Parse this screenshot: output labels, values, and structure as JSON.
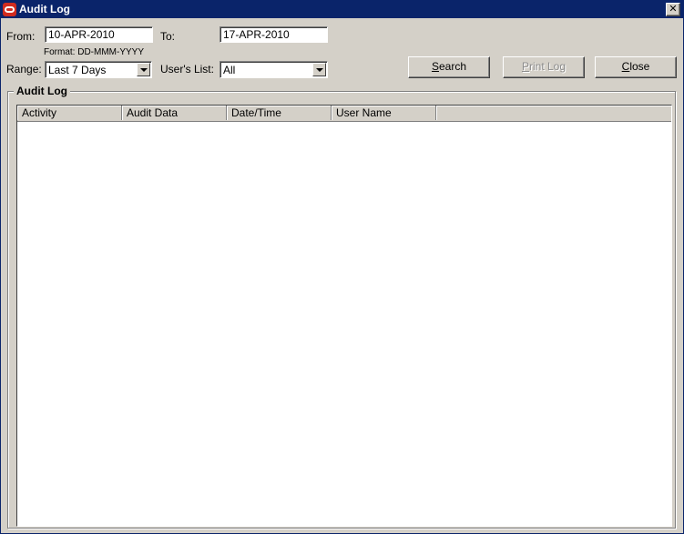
{
  "window": {
    "title": "Audit Log",
    "close_glyph": "✕"
  },
  "form": {
    "from_label": "From:",
    "from_value": "10-APR-2010",
    "to_label": "To:",
    "to_value": "17-APR-2010",
    "format_hint": "Format: DD-MMM-YYYY",
    "range_label": "Range:",
    "range_value": "Last 7 Days",
    "users_label": "User's List:",
    "users_value": "All"
  },
  "buttons": {
    "search_accel": "S",
    "search_rest": "earch",
    "print_accel": "P",
    "print_rest": "rint Log",
    "close_accel": "C",
    "close_rest": "lose"
  },
  "group": {
    "title": "Audit Log"
  },
  "grid": {
    "columns": [
      "Activity",
      "Audit Data",
      "Date/Time",
      "User Name"
    ],
    "rows": []
  },
  "icons": {
    "app": "oracle-logo-icon",
    "close": "close-icon",
    "dropdown": "chevron-down-icon"
  }
}
